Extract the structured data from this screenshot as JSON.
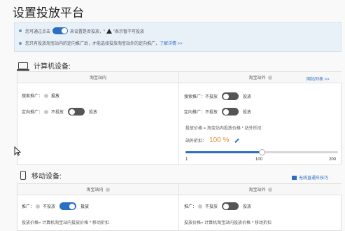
{
  "dialog": {
    "title": "设置投放平台"
  },
  "notice": {
    "line1_prefix": "您可通过点击",
    "line1_middle": "来设置是否投放，“",
    "line1_suffix": "”表示暂不可投放",
    "line2_text": "您只有投放淘宝站内的定向推广后，才能选择投放淘宝站外的定向推广，",
    "line2_link": "了解详情 >>"
  },
  "computer": {
    "section_title": "计算机设备:",
    "col_inside": "淘宝站内",
    "col_outside": "淘宝站外",
    "site_list_link": "网站列表 >>",
    "inside": {
      "search_label": "搜索推广：",
      "search_status": "投放",
      "target_label": "定向推广：",
      "target_toggle_text": "不投放",
      "target_state_text": "投放"
    },
    "outside": {
      "search_label": "搜索推广：",
      "search_toggle_text": "不投放",
      "search_state_text": "投放",
      "target_label": "定向推广：",
      "target_toggle_text": "不投放",
      "target_state_text": "投放",
      "price_formula": "投放价格 = 淘宝站内投放价格 * 站外折扣",
      "discount_label": "站外折扣：",
      "discount_value": "100 %",
      "slider": {
        "min": "1",
        "mid": "100",
        "max": "200",
        "value_fraction": 0.5
      }
    }
  },
  "mobile": {
    "section_title": "移动设备:",
    "guide_link": "无线直通车技巧",
    "col_inside": "淘宝站内",
    "col_outside": "淘宝站外",
    "inside": {
      "promo_label": "推广：",
      "toggle_text": "不投放",
      "state_text": "投放",
      "price_formula": "投放价格= 计算机淘宝站内投放价格 * 移动折扣"
    },
    "outside": {
      "promo_label": "推广：",
      "toggle_text": "不投放",
      "state_text": "投放",
      "price_formula": "投放价格= 计算机淘宝站内投放价格 * 移动折扣"
    }
  },
  "colors": {
    "accent": "#2b6fc2",
    "discount": "#e38a2c",
    "toggle_off": "#555555"
  }
}
